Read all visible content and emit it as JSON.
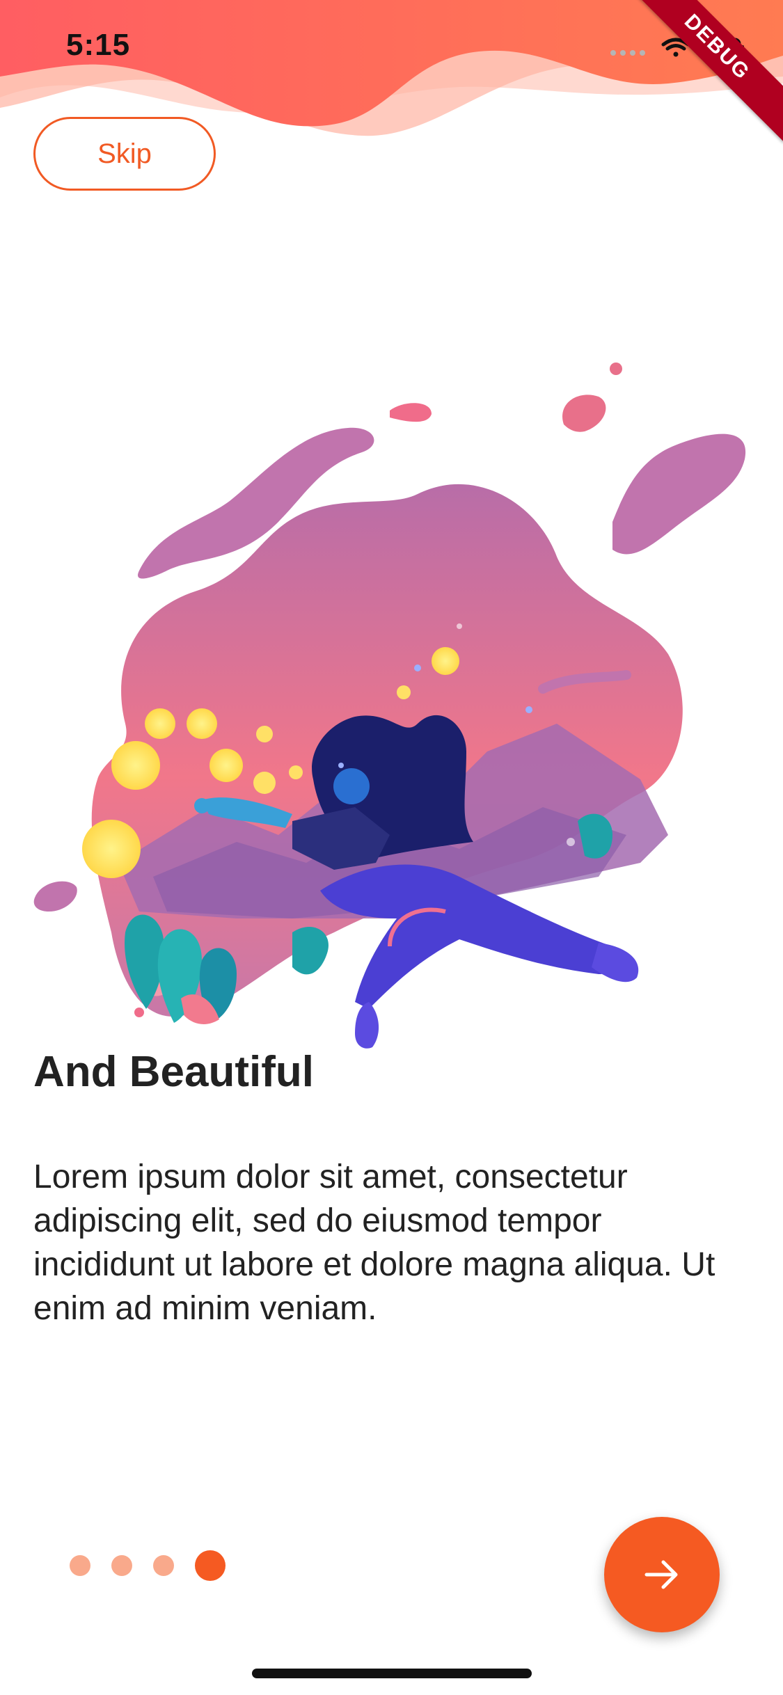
{
  "status_bar": {
    "time": "5:15",
    "icons": [
      "cellular-dots-icon",
      "wifi-icon",
      "battery-icon"
    ]
  },
  "debug_banner": {
    "label": "DEBUG"
  },
  "onboarding": {
    "skip_label": "Skip",
    "title": "And Beautiful",
    "body": "Lorem ipsum dolor sit amet, consectetur adipiscing elit, sed do eiusmod tempor incididunt ut labore et dolore magna aliqua. Ut enim ad minim veniam.",
    "page_indicator": {
      "total": 4,
      "current": 4
    },
    "next_icon": "arrow-right-icon"
  },
  "colors": {
    "accent": "#f55a22",
    "accent_light": "#f9a98b",
    "wave_top": "#ff6b4a",
    "wave_light": "#ffd9d0",
    "debug_ribbon": "#b00020"
  }
}
